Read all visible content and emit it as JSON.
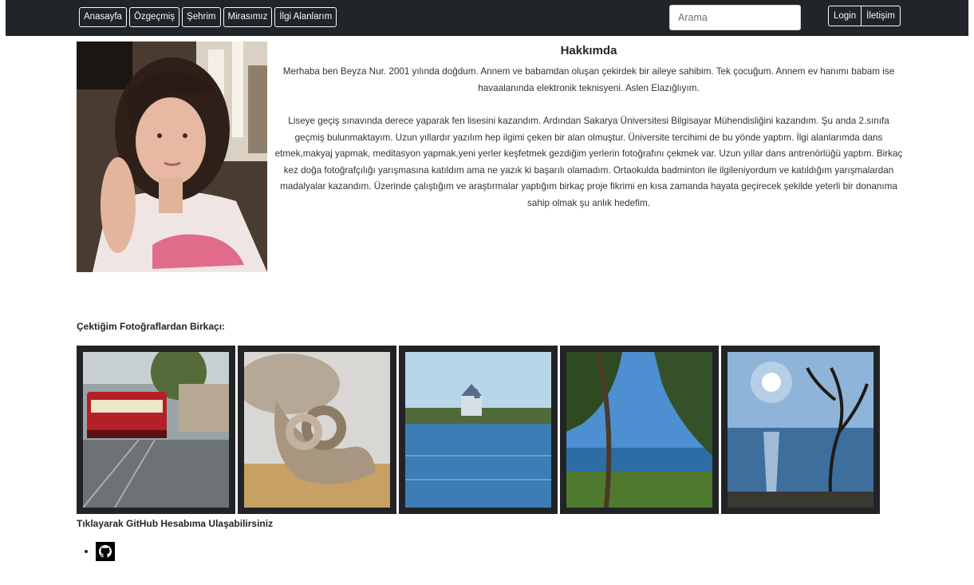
{
  "nav": {
    "items": [
      {
        "id": "home",
        "label": "Anasayfa"
      },
      {
        "id": "cv",
        "label": "Özgeçmiş"
      },
      {
        "id": "city",
        "label": "Şehrim"
      },
      {
        "id": "heritage",
        "label": "Mirasımız"
      },
      {
        "id": "interests",
        "label": "İlgi Alanlarım"
      }
    ],
    "search_placeholder": "Arama",
    "login_label": "Login",
    "contact_label": "İletişim"
  },
  "about": {
    "title": "Hakkımda",
    "paragraph1": "Merhaba ben Beyza Nur. 2001 yılında doğdum. Annem ve babamdan oluşan çekirdek bir aileye sahibim. Tek çocuğum. Annem ev hanımı babam ise havaalanında elektronik teknisyeni. Aslen Elazığlıyım.",
    "paragraph2": "Liseye geçiş sınavında derece yaparak fen lisesini kazandım. Ardından Sakarya Üniversitesi Bilgisayar Mühendisliğini kazandım. Şu anda 2.sınıfa geçmiş bulunmaktayım. Uzun yıllardır yazılım hep ilgimi çeken bir alan olmuştur. Üniversite tercihimi de bu yönde yaptım. İlgi alanlarımda dans etmek,makyaj yapmak, meditasyon yapmak,yeni yerler keşfetmek gezdiğim yerlerin fotoğrafını çekmek var. Uzun yıllar dans antrenörlüğü yaptım. Birkaç kez doğa fotoğrafçılığı yarışmasına katıldım ama ne yazık ki başarılı olamadım. Ortaokulda badminton ile ilgileniyordum ve katıldığım yarışmalardan madalyalar kazandım. Üzerinde çalıştığım ve araştırmalar yaptığım birkaç proje fikrimi en kısa zamanda hayata geçirecek şekilde yeterli bir donanıma sahip olmak şu anlık hedefim."
  },
  "gallery": {
    "title": "Çektiğim Fotoğraflardan Birkaçı:"
  },
  "github": {
    "title": "Tıklayarak GitHub Hesabıma Ulaşabilirsiniz"
  },
  "colors": {
    "navbar_bg": "#212529",
    "tile_frame": "#222326"
  }
}
